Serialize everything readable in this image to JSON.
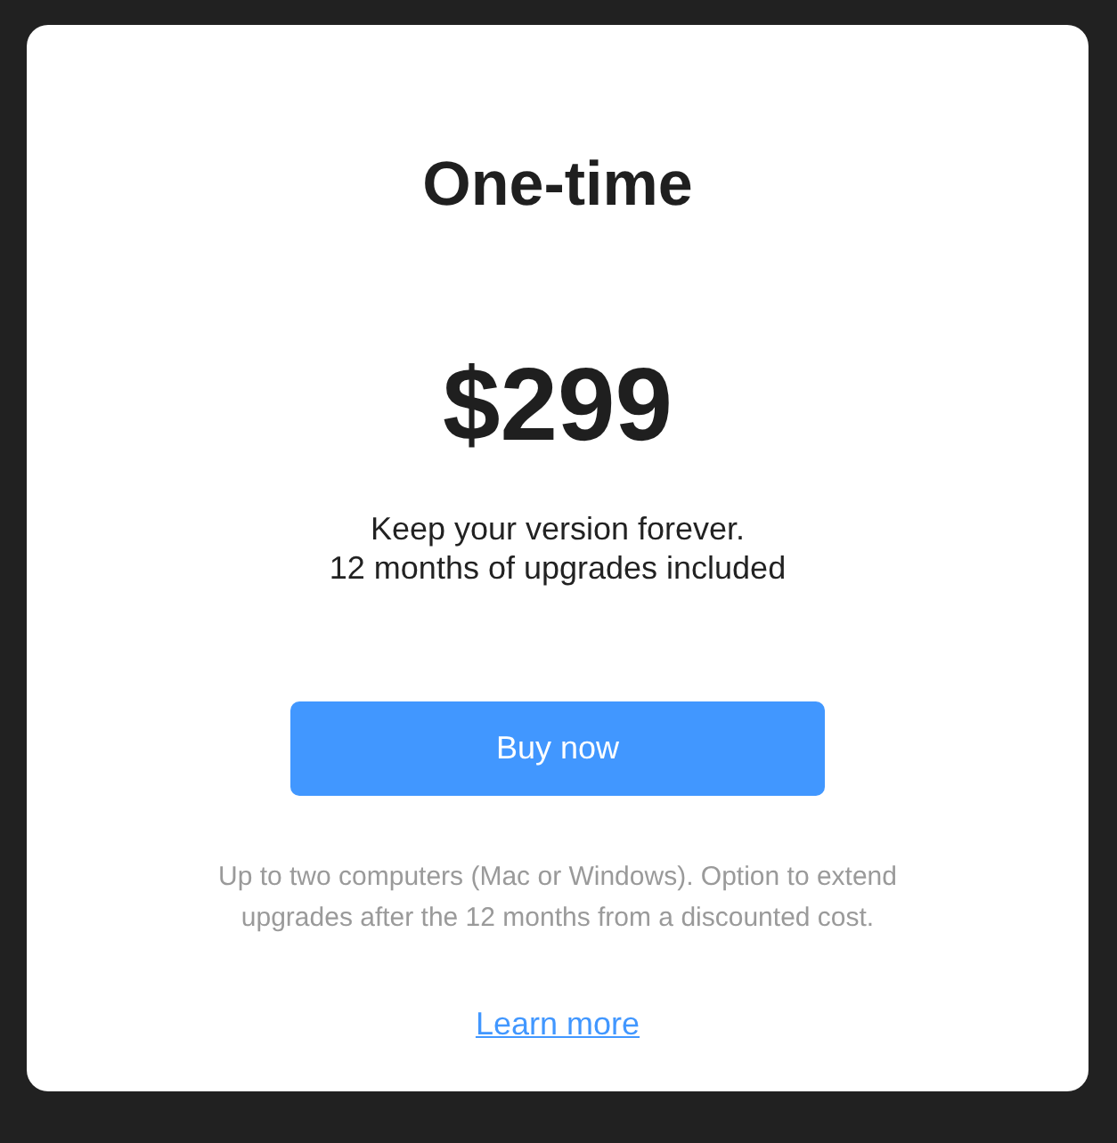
{
  "plan": {
    "title": "One-time",
    "price": "$299",
    "description": [
      "Keep your version forever.",
      "12 months of upgrades included"
    ],
    "button": "Buy now",
    "note": "Up to two computers (Mac or Windows). Option to extend upgrades after the 12 months from a discounted cost.",
    "link": "Learn more"
  }
}
